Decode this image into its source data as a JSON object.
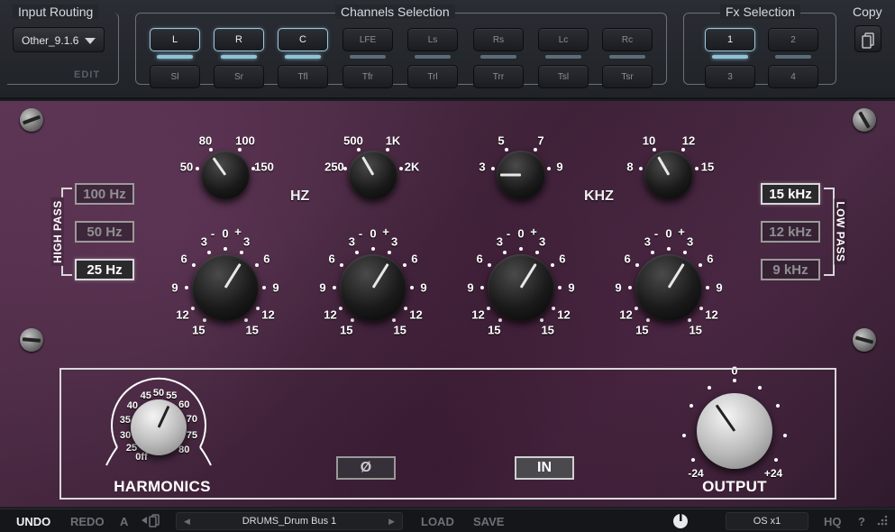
{
  "topbar": {
    "input_routing": {
      "title": "Input Routing",
      "selected": "Other_9.1.6",
      "edit_label": "EDIT"
    },
    "channels": {
      "title": "Channels Selection",
      "row1": [
        {
          "label": "L",
          "on": true
        },
        {
          "label": "R",
          "on": true
        },
        {
          "label": "C",
          "on": true
        },
        {
          "label": "LFE",
          "on": false
        },
        {
          "label": "Ls",
          "on": false
        },
        {
          "label": "Rs",
          "on": false
        },
        {
          "label": "Lc",
          "on": false
        },
        {
          "label": "Rc",
          "on": false
        }
      ],
      "row2": [
        {
          "label": "Sl"
        },
        {
          "label": "Sr"
        },
        {
          "label": "Tfl"
        },
        {
          "label": "Tfr"
        },
        {
          "label": "Trl"
        },
        {
          "label": "Trr"
        },
        {
          "label": "Tsl"
        },
        {
          "label": "Tsr"
        }
      ]
    },
    "fx": {
      "title": "Fx Selection",
      "buttons": [
        {
          "label": "1",
          "on": true
        },
        {
          "label": "2"
        },
        {
          "label": "3"
        },
        {
          "label": "4"
        }
      ]
    },
    "copy": {
      "title": "Copy"
    }
  },
  "panel": {
    "hz_unit": "HZ",
    "khz_unit": "KHZ",
    "freq_knobs": [
      {
        "scale": [
          "50",
          "80",
          "100",
          "150"
        ]
      },
      {
        "scale": [
          "250",
          "500",
          "1K",
          "2K"
        ]
      },
      {
        "scale": [
          "3",
          "5",
          "7",
          "9"
        ]
      },
      {
        "scale": [
          "8",
          "10",
          "12",
          "15"
        ]
      }
    ],
    "gain_scale": {
      "left": [
        "3",
        "6",
        "9",
        "12",
        "15"
      ],
      "right": [
        "3",
        "6",
        "9",
        "12",
        "15"
      ],
      "top": [
        "-",
        "0",
        "+"
      ]
    },
    "high_pass": {
      "title": "HIGH PASS",
      "options": [
        "100 Hz",
        "50 Hz",
        "25 Hz"
      ],
      "selected": "25 Hz"
    },
    "low_pass": {
      "title": "LOW PASS",
      "options": [
        "15 kHz",
        "12 kHz",
        "9 kHz"
      ],
      "selected": "15 kHz"
    },
    "harmonics": {
      "title": "HARMONICS",
      "scale": [
        "0ff",
        "25",
        "30",
        "35",
        "40",
        "45",
        "50",
        "55",
        "60",
        "70",
        "75",
        "80"
      ]
    },
    "phase_label": "Ø",
    "in_label": "IN",
    "output": {
      "title": "OUTPUT",
      "scale": [
        "0",
        "-24",
        "+24"
      ]
    }
  },
  "bottombar": {
    "undo": "UNDO",
    "redo": "REDO",
    "ab": "A",
    "preset_name": "DRUMS_Drum Bus 1",
    "load": "LOAD",
    "save": "SAVE",
    "oversampling": "OS x1",
    "hq": "HQ",
    "help": "?"
  }
}
